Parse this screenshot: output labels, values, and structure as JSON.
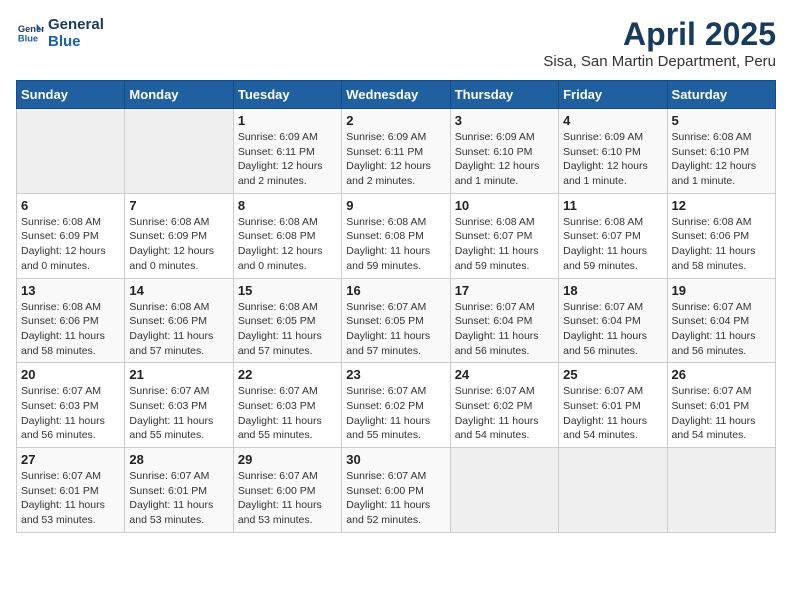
{
  "logo": {
    "line1": "General",
    "line2": "Blue"
  },
  "title": "April 2025",
  "subtitle": "Sisa, San Martin Department, Peru",
  "weekdays": [
    "Sunday",
    "Monday",
    "Tuesday",
    "Wednesday",
    "Thursday",
    "Friday",
    "Saturday"
  ],
  "weeks": [
    [
      {
        "day": "",
        "detail": ""
      },
      {
        "day": "",
        "detail": ""
      },
      {
        "day": "1",
        "detail": "Sunrise: 6:09 AM\nSunset: 6:11 PM\nDaylight: 12 hours and 2 minutes."
      },
      {
        "day": "2",
        "detail": "Sunrise: 6:09 AM\nSunset: 6:11 PM\nDaylight: 12 hours and 2 minutes."
      },
      {
        "day": "3",
        "detail": "Sunrise: 6:09 AM\nSunset: 6:10 PM\nDaylight: 12 hours and 1 minute."
      },
      {
        "day": "4",
        "detail": "Sunrise: 6:09 AM\nSunset: 6:10 PM\nDaylight: 12 hours and 1 minute."
      },
      {
        "day": "5",
        "detail": "Sunrise: 6:08 AM\nSunset: 6:10 PM\nDaylight: 12 hours and 1 minute."
      }
    ],
    [
      {
        "day": "6",
        "detail": "Sunrise: 6:08 AM\nSunset: 6:09 PM\nDaylight: 12 hours and 0 minutes."
      },
      {
        "day": "7",
        "detail": "Sunrise: 6:08 AM\nSunset: 6:09 PM\nDaylight: 12 hours and 0 minutes."
      },
      {
        "day": "8",
        "detail": "Sunrise: 6:08 AM\nSunset: 6:08 PM\nDaylight: 12 hours and 0 minutes."
      },
      {
        "day": "9",
        "detail": "Sunrise: 6:08 AM\nSunset: 6:08 PM\nDaylight: 11 hours and 59 minutes."
      },
      {
        "day": "10",
        "detail": "Sunrise: 6:08 AM\nSunset: 6:07 PM\nDaylight: 11 hours and 59 minutes."
      },
      {
        "day": "11",
        "detail": "Sunrise: 6:08 AM\nSunset: 6:07 PM\nDaylight: 11 hours and 59 minutes."
      },
      {
        "day": "12",
        "detail": "Sunrise: 6:08 AM\nSunset: 6:06 PM\nDaylight: 11 hours and 58 minutes."
      }
    ],
    [
      {
        "day": "13",
        "detail": "Sunrise: 6:08 AM\nSunset: 6:06 PM\nDaylight: 11 hours and 58 minutes."
      },
      {
        "day": "14",
        "detail": "Sunrise: 6:08 AM\nSunset: 6:06 PM\nDaylight: 11 hours and 57 minutes."
      },
      {
        "day": "15",
        "detail": "Sunrise: 6:08 AM\nSunset: 6:05 PM\nDaylight: 11 hours and 57 minutes."
      },
      {
        "day": "16",
        "detail": "Sunrise: 6:07 AM\nSunset: 6:05 PM\nDaylight: 11 hours and 57 minutes."
      },
      {
        "day": "17",
        "detail": "Sunrise: 6:07 AM\nSunset: 6:04 PM\nDaylight: 11 hours and 56 minutes."
      },
      {
        "day": "18",
        "detail": "Sunrise: 6:07 AM\nSunset: 6:04 PM\nDaylight: 11 hours and 56 minutes."
      },
      {
        "day": "19",
        "detail": "Sunrise: 6:07 AM\nSunset: 6:04 PM\nDaylight: 11 hours and 56 minutes."
      }
    ],
    [
      {
        "day": "20",
        "detail": "Sunrise: 6:07 AM\nSunset: 6:03 PM\nDaylight: 11 hours and 56 minutes."
      },
      {
        "day": "21",
        "detail": "Sunrise: 6:07 AM\nSunset: 6:03 PM\nDaylight: 11 hours and 55 minutes."
      },
      {
        "day": "22",
        "detail": "Sunrise: 6:07 AM\nSunset: 6:03 PM\nDaylight: 11 hours and 55 minutes."
      },
      {
        "day": "23",
        "detail": "Sunrise: 6:07 AM\nSunset: 6:02 PM\nDaylight: 11 hours and 55 minutes."
      },
      {
        "day": "24",
        "detail": "Sunrise: 6:07 AM\nSunset: 6:02 PM\nDaylight: 11 hours and 54 minutes."
      },
      {
        "day": "25",
        "detail": "Sunrise: 6:07 AM\nSunset: 6:01 PM\nDaylight: 11 hours and 54 minutes."
      },
      {
        "day": "26",
        "detail": "Sunrise: 6:07 AM\nSunset: 6:01 PM\nDaylight: 11 hours and 54 minutes."
      }
    ],
    [
      {
        "day": "27",
        "detail": "Sunrise: 6:07 AM\nSunset: 6:01 PM\nDaylight: 11 hours and 53 minutes."
      },
      {
        "day": "28",
        "detail": "Sunrise: 6:07 AM\nSunset: 6:01 PM\nDaylight: 11 hours and 53 minutes."
      },
      {
        "day": "29",
        "detail": "Sunrise: 6:07 AM\nSunset: 6:00 PM\nDaylight: 11 hours and 53 minutes."
      },
      {
        "day": "30",
        "detail": "Sunrise: 6:07 AM\nSunset: 6:00 PM\nDaylight: 11 hours and 52 minutes."
      },
      {
        "day": "",
        "detail": ""
      },
      {
        "day": "",
        "detail": ""
      },
      {
        "day": "",
        "detail": ""
      }
    ]
  ]
}
